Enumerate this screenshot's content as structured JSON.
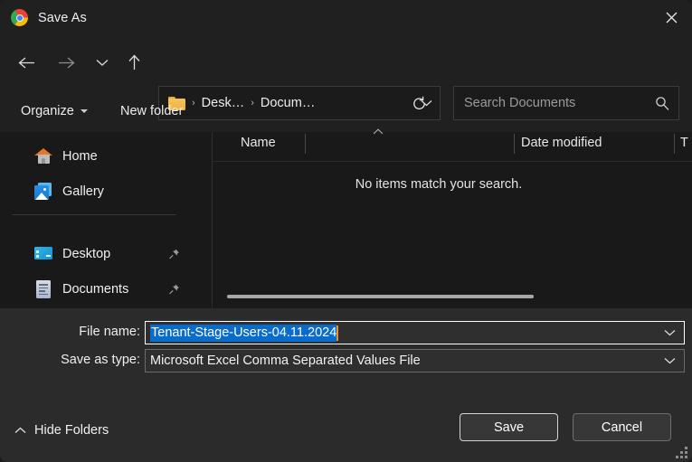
{
  "window": {
    "title": "Save As",
    "app_icon": "chrome-icon",
    "close_label": "×"
  },
  "nav": {
    "back": "back-arrow-icon",
    "forward": "forward-arrow-icon",
    "recent": "chevron-down-icon",
    "up": "up-arrow-icon"
  },
  "address": {
    "folder_icon": "folder-icon",
    "crumbs": [
      "Desk…",
      "Docum…"
    ],
    "separator": "›",
    "dropdown_icon": "chevron-down-icon",
    "refresh_icon": "refresh-icon"
  },
  "search": {
    "placeholder": "Search Documents",
    "icon": "search-icon"
  },
  "toolbar": {
    "organize_label": "Organize",
    "new_folder_label": "New folder",
    "view_icon": "view-options-icon",
    "view_chevron": "chevron-down-icon",
    "help_label": "?"
  },
  "sidebar": {
    "items": [
      {
        "label": "Home",
        "icon": "home-icon",
        "pinned": false
      },
      {
        "label": "Gallery",
        "icon": "gallery-icon",
        "pinned": false
      },
      {
        "label": "Desktop",
        "icon": "desktop-icon",
        "pinned": true
      },
      {
        "label": "Documents",
        "icon": "documents-icon",
        "pinned": true
      }
    ]
  },
  "filelist": {
    "columns": [
      "Name",
      "Date modified",
      "T"
    ],
    "sort_indicator": "ascending",
    "empty_message": "No items match your search.",
    "rows": []
  },
  "form": {
    "filename_label": "File name:",
    "filename_value": "Tenant-Stage-Users-04.11.2024",
    "savetype_label": "Save as type:",
    "savetype_value": "Microsoft Excel Comma Separated Values File",
    "dropdown_icon": "chevron-down-icon"
  },
  "footer": {
    "hide_folders_label": "Hide Folders",
    "hide_folders_icon": "chevron-up-icon",
    "save_label": "Save",
    "cancel_label": "Cancel"
  },
  "colors": {
    "accent_blue": "#1273d4",
    "selection_blue": "#0a6cca",
    "caret_orange": "#e8942e",
    "dialog_bg": "#202020",
    "panel_bg": "#2b2b2b"
  }
}
